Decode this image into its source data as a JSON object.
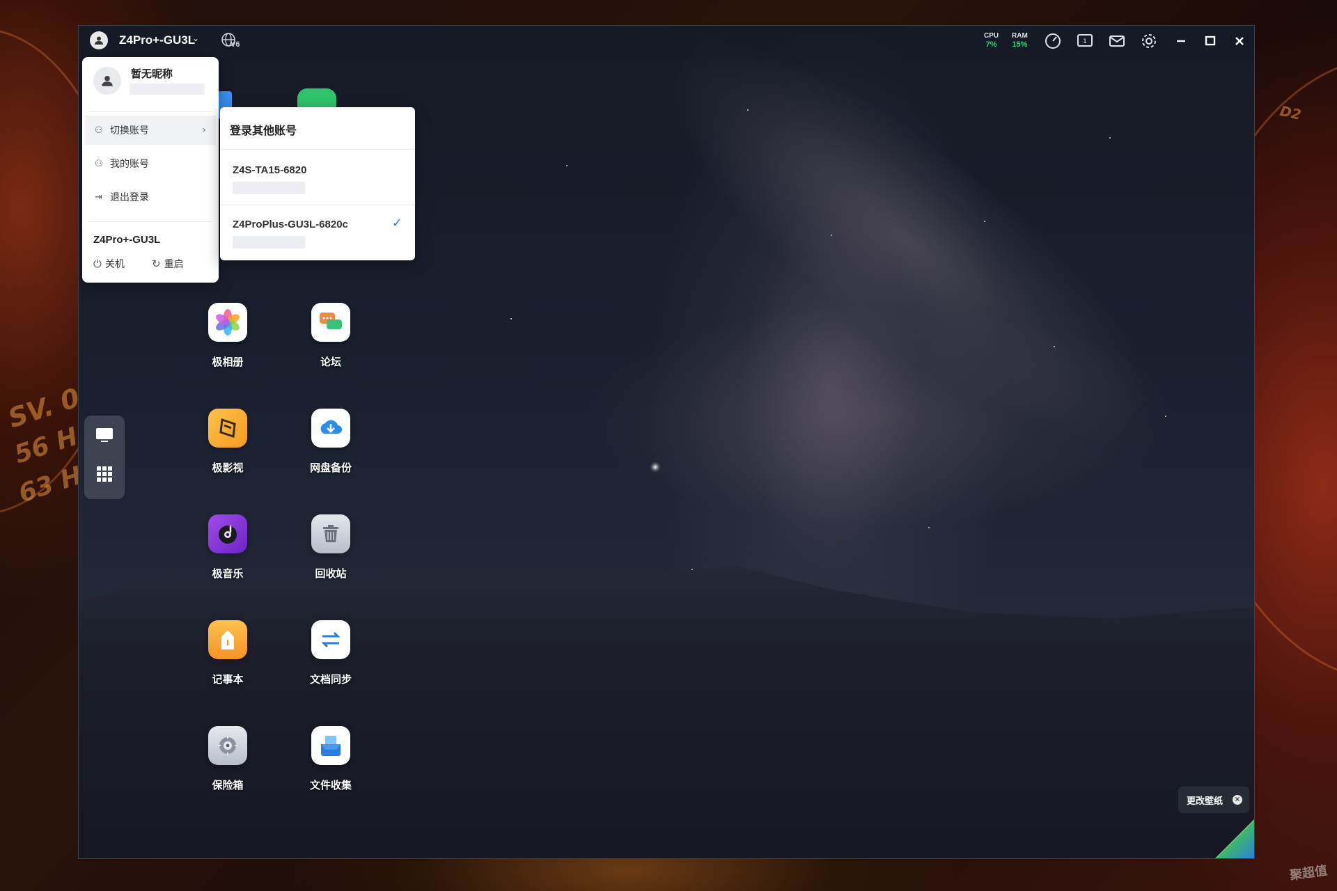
{
  "titlebar": {
    "device_name": "Z4Pro+-GU3L",
    "ipv6_label": "V6",
    "cpu": {
      "label": "CPU",
      "value": "7%"
    },
    "ram": {
      "label": "RAM",
      "value": "15%"
    },
    "icons": [
      "speed-icon",
      "monitor-icon",
      "mail-icon",
      "gear-icon",
      "minimize-icon",
      "maximize-icon",
      "close-icon"
    ]
  },
  "user_menu": {
    "nickname": "暂无昵称",
    "items": [
      {
        "label": "切换账号",
        "icon": "switch-account-icon"
      },
      {
        "label": "我的账号",
        "icon": "user-icon"
      },
      {
        "label": "退出登录",
        "icon": "logout-icon"
      }
    ],
    "device": "Z4Pro+-GU3L",
    "shutdown": "关机",
    "restart": "重启"
  },
  "sub_menu": {
    "title": "登录其他账号",
    "accounts": [
      {
        "name": "Z4S-TA15-6820",
        "selected": false
      },
      {
        "name": "Z4ProPlus-GU3L-6820c",
        "selected": true
      }
    ]
  },
  "apps": [
    {
      "label": "极相册",
      "icon": "photos-icon",
      "color": "#ffffff"
    },
    {
      "label": "论坛",
      "icon": "forum-icon",
      "color": "#ffffff"
    },
    {
      "label": "极影视",
      "icon": "video-icon",
      "color": "#f5a623"
    },
    {
      "label": "网盘备份",
      "icon": "cloud-backup-icon",
      "color": "#ffffff"
    },
    {
      "label": "极音乐",
      "icon": "music-icon",
      "color": "#8e3bd8"
    },
    {
      "label": "回收站",
      "icon": "trash-icon",
      "color": "#c9ced6"
    },
    {
      "label": "记事本",
      "icon": "notepad-icon",
      "color": "#f8a93a"
    },
    {
      "label": "文档同步",
      "icon": "sync-icon",
      "color": "#ffffff"
    },
    {
      "label": "保险箱",
      "icon": "safe-icon",
      "color": "#d9dde3"
    },
    {
      "label": "文件收集",
      "icon": "file-collect-icon",
      "color": "#ffffff"
    }
  ],
  "wallpaper": {
    "button_label": "更改壁纸"
  },
  "watermark": "聚超值",
  "colors": {
    "accent": "#3a7bf0",
    "stat_green": "#34d17a"
  }
}
